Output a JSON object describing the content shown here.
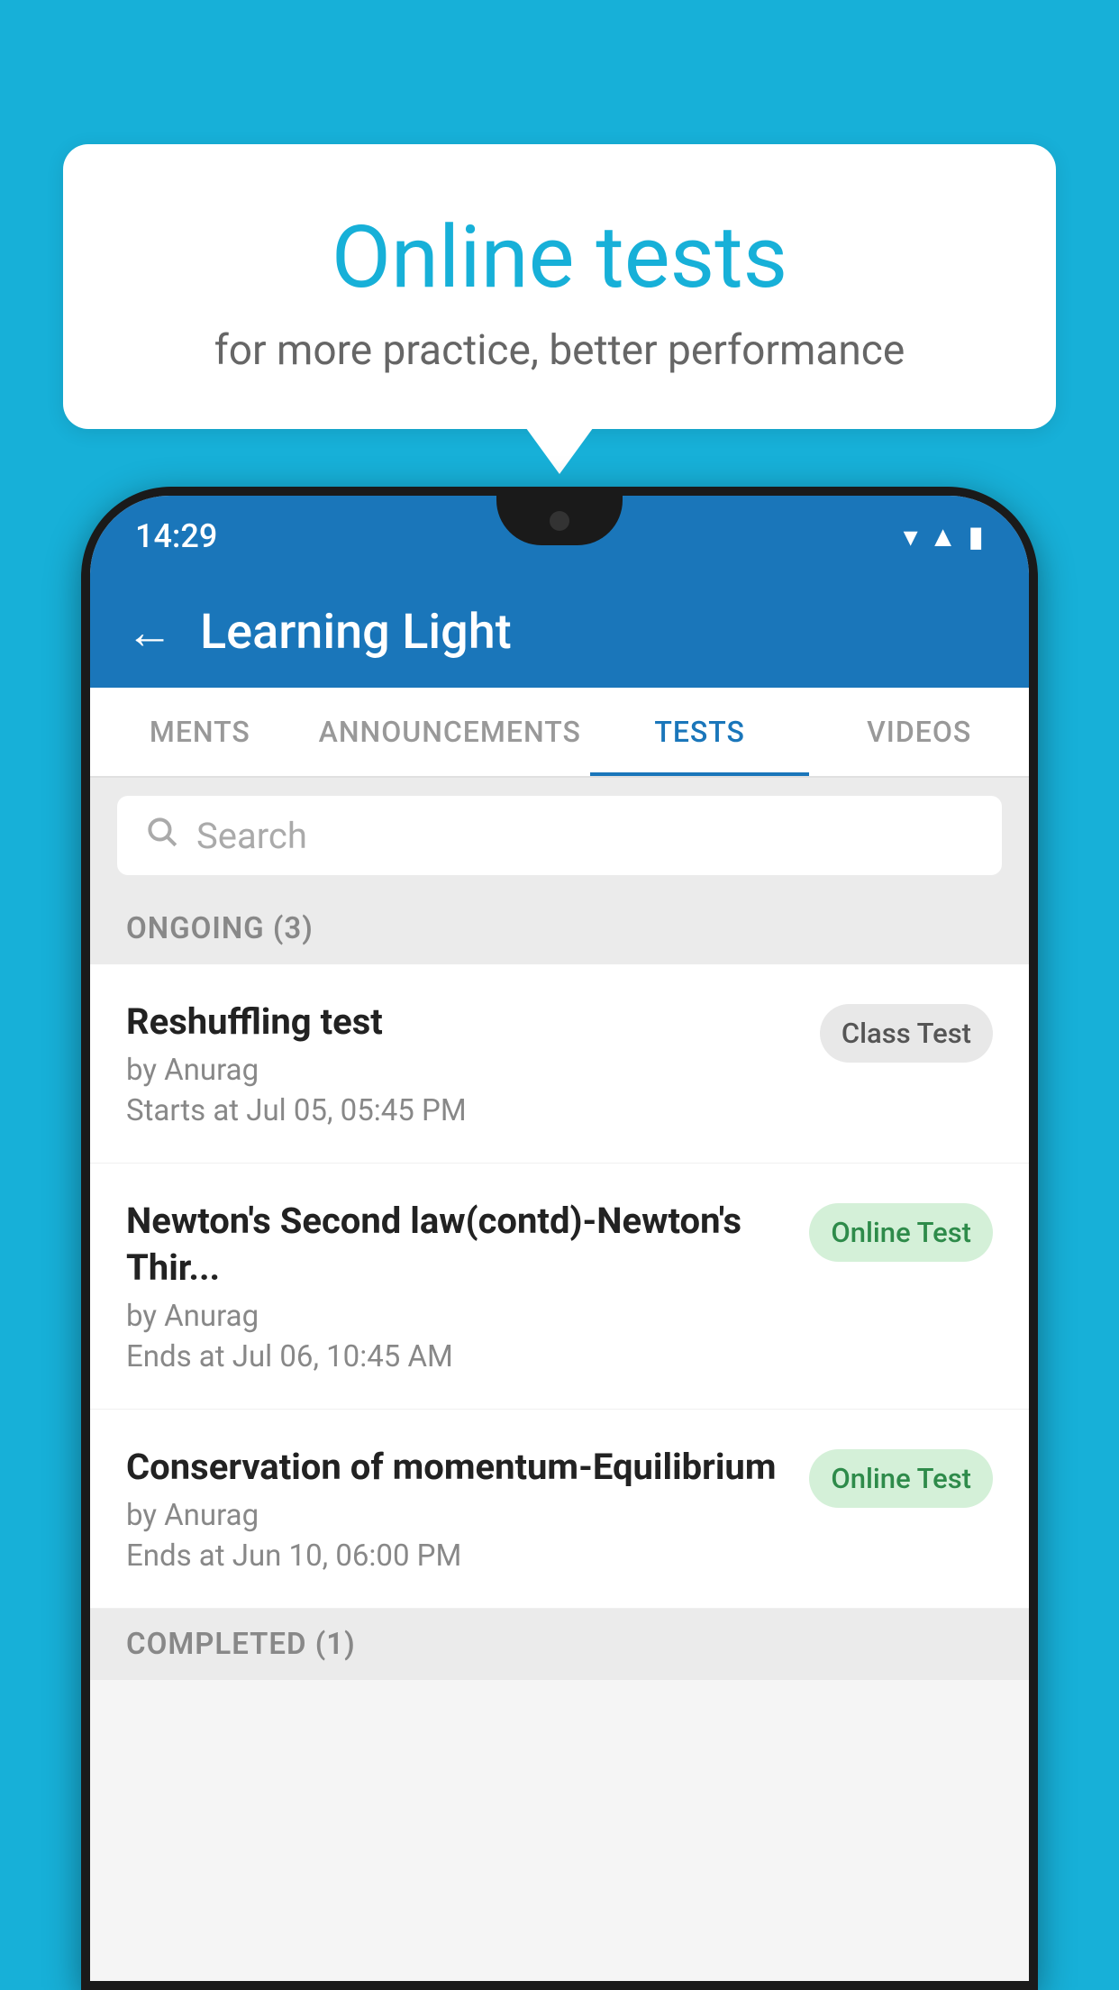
{
  "background_color": "#17b0d8",
  "bubble": {
    "title": "Online tests",
    "subtitle": "for more practice, better performance"
  },
  "status_bar": {
    "time": "14:29",
    "icons": [
      "wifi",
      "signal",
      "battery"
    ]
  },
  "app_header": {
    "title": "Learning Light",
    "back_label": "←"
  },
  "tabs": [
    {
      "label": "MENTS",
      "active": false
    },
    {
      "label": "ANNOUNCEMENTS",
      "active": false
    },
    {
      "label": "TESTS",
      "active": true
    },
    {
      "label": "VIDEOS",
      "active": false
    }
  ],
  "search": {
    "placeholder": "Search"
  },
  "ongoing_section": {
    "label": "ONGOING (3)"
  },
  "test_items": [
    {
      "name": "Reshuffling test",
      "by": "by Anurag",
      "date": "Starts at  Jul 05, 05:45 PM",
      "badge": "Class Test",
      "badge_type": "class"
    },
    {
      "name": "Newton's Second law(contd)-Newton's Thir...",
      "by": "by Anurag",
      "date": "Ends at  Jul 06, 10:45 AM",
      "badge": "Online Test",
      "badge_type": "online"
    },
    {
      "name": "Conservation of momentum-Equilibrium",
      "by": "by Anurag",
      "date": "Ends at  Jun 10, 06:00 PM",
      "badge": "Online Test",
      "badge_type": "online"
    }
  ],
  "completed_section": {
    "label": "COMPLETED (1)"
  }
}
